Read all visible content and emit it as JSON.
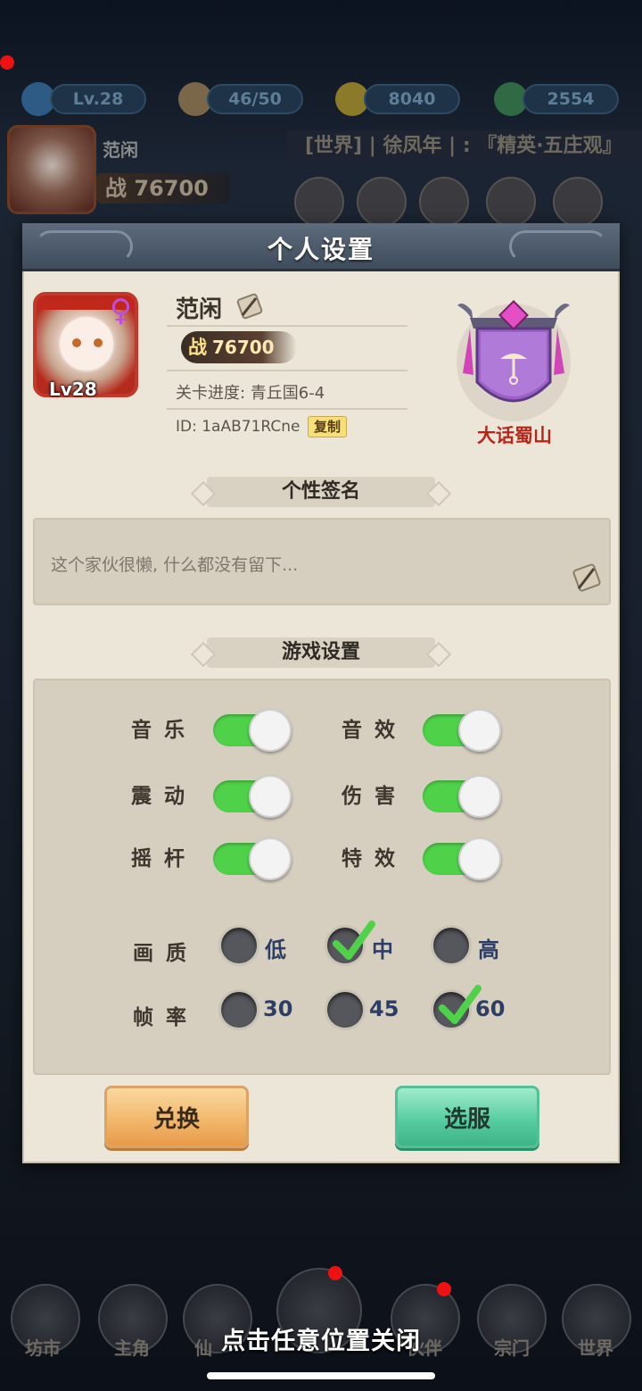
{
  "hud": {
    "level": "Lv.28",
    "stamina": "46/50",
    "coins": "8040",
    "jade": "2554",
    "player_name": "范闲",
    "power_label": "战 76700",
    "world_chat": "[世界] | 徐凤年 | : 『精英·五庄观』"
  },
  "dialog": {
    "title": "个人设置",
    "profile": {
      "level": "Lv28",
      "gender": "♀",
      "name": "范闲",
      "power_prefix": "战",
      "power": "76700",
      "progress": "关卡进度: 青丘国6-4",
      "id": "ID: 1aAB71RCne",
      "copy_label": "复制",
      "sect": "大话蜀山"
    },
    "signature": {
      "header": "个性签名",
      "text": "这个家伙很懒, 什么都没有留下..."
    },
    "game_settings": {
      "header": "游戏设置",
      "toggles": [
        {
          "label": "音乐",
          "on": true
        },
        {
          "label": "音效",
          "on": true
        },
        {
          "label": "震动",
          "on": true
        },
        {
          "label": "伤害",
          "on": true
        },
        {
          "label": "摇杆",
          "on": true
        },
        {
          "label": "特效",
          "on": true
        }
      ],
      "quality": {
        "label": "画质",
        "options": [
          "低",
          "中",
          "高"
        ],
        "selected": "中"
      },
      "framerate": {
        "label": "帧率",
        "options": [
          "30",
          "45",
          "60"
        ],
        "selected": "60"
      }
    },
    "buttons": {
      "exchange": "兑换",
      "select_server": "选服"
    }
  },
  "bottom_nav": [
    "坊市",
    "主角",
    "仙",
    "伙伴",
    "宗门",
    "世界"
  ],
  "close_hint": "点击任意位置关闭",
  "colors": {
    "toggle_on": "#4fd24a",
    "dialog_bg": "#ece6d8",
    "header_bg": "#4a5767",
    "sect_red": "#b8261a",
    "check_green": "#4fd24a"
  }
}
